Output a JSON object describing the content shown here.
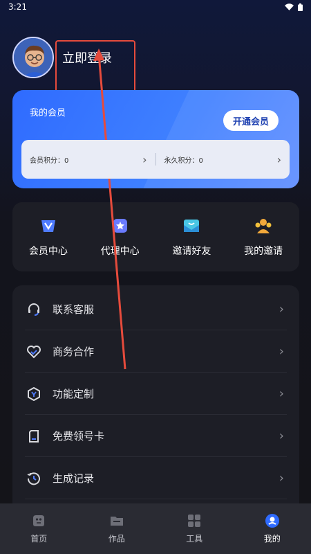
{
  "status_bar": {
    "time": "3:21"
  },
  "profile": {
    "login_label": "立即登录"
  },
  "member_card": {
    "title": "我的会员",
    "open_button": "开通会员",
    "points_label": "会员积分：0",
    "permanent_points_label": "永久积分：0"
  },
  "quick_actions": {
    "items": [
      {
        "label": "会员中心",
        "icon": "vip-icon"
      },
      {
        "label": "代理中心",
        "icon": "agent-star-icon"
      },
      {
        "label": "邀请好友",
        "icon": "invite-envelope-icon"
      },
      {
        "label": "我的邀请",
        "icon": "people-icon"
      }
    ]
  },
  "menu": {
    "items": [
      {
        "label": "联系客服",
        "icon": "headset-icon"
      },
      {
        "label": "商务合作",
        "icon": "handshake-heart-icon"
      },
      {
        "label": "功能定制",
        "icon": "cube-icon"
      },
      {
        "label": "免费领号卡",
        "icon": "sim-card-icon"
      },
      {
        "label": "生成记录",
        "icon": "history-icon"
      }
    ]
  },
  "bottom_nav": {
    "items": [
      {
        "label": "首页",
        "icon": "home-icon"
      },
      {
        "label": "作品",
        "icon": "folder-icon"
      },
      {
        "label": "工具",
        "icon": "grid-icon"
      },
      {
        "label": "我的",
        "icon": "profile-icon",
        "active": true
      }
    ]
  },
  "colors": {
    "accent": "#3f80ff",
    "annotation": "#e64b3c",
    "panel": "#1d1e26"
  }
}
